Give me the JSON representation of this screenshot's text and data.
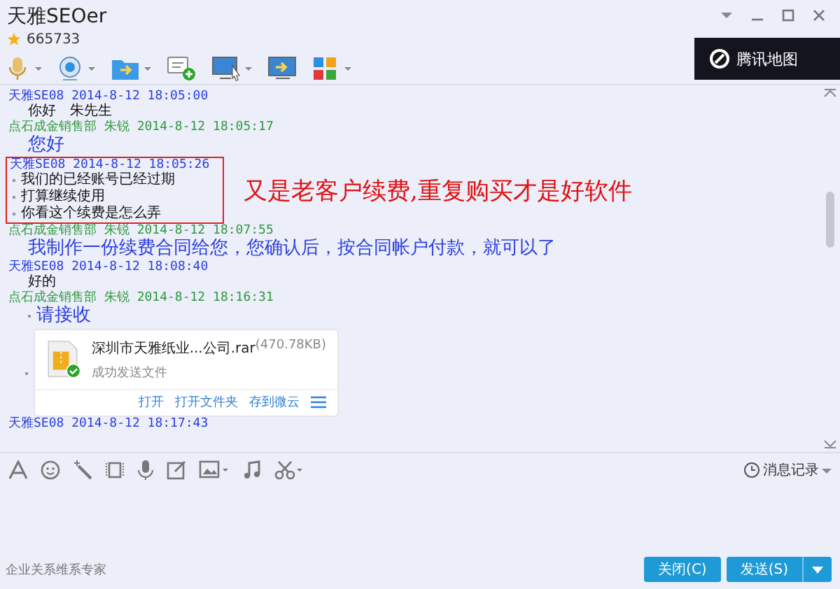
{
  "window": {
    "title": "天雅SEOer",
    "account": "665733"
  },
  "map_banner": {
    "label": "腾讯地图"
  },
  "messages": [
    {
      "sender": "天雅SE08",
      "time": "2014-8-12 18:05:00",
      "kind": "me",
      "highlighted": false,
      "lines": [
        {
          "text": "你好　朱先生",
          "kind": "normal",
          "bulleted": false
        }
      ]
    },
    {
      "sender": "点石成金销售部 朱锐",
      "time": "2014-8-12 18:05:17",
      "kind": "contact",
      "highlighted": false,
      "lines": [
        {
          "text": "您好",
          "kind": "large",
          "bulleted": false
        }
      ]
    },
    {
      "sender": "天雅SE08",
      "time": "2014-8-12 18:05:26",
      "kind": "me",
      "highlighted": true,
      "annotation": "又是老客户续费,重复购买才是好软件",
      "lines": [
        {
          "text": "我们的已经账号已经过期",
          "kind": "normal",
          "bulleted": true
        },
        {
          "text": "打算继续使用",
          "kind": "normal",
          "bulleted": true
        },
        {
          "text": "你看这个续费是怎么弄",
          "kind": "normal",
          "bulleted": true
        }
      ]
    },
    {
      "sender": "点石成金销售部 朱锐",
      "time": "2014-8-12 18:07:55",
      "kind": "contact",
      "highlighted": false,
      "lines": [
        {
          "text": "我制作一份续费合同给您，您确认后，按合同帐户付款，就可以了",
          "kind": "large",
          "bulleted": false
        }
      ]
    },
    {
      "sender": "天雅SE08",
      "time": "2014-8-12 18:08:40",
      "kind": "me",
      "highlighted": false,
      "lines": [
        {
          "text": "好的",
          "kind": "normal",
          "bulleted": false
        }
      ]
    },
    {
      "sender": "点石成金销售部 朱锐",
      "time": "2014-8-12 18:16:31",
      "kind": "contact",
      "highlighted": false,
      "lines": [
        {
          "text": "请接收",
          "kind": "large",
          "bulleted": true
        }
      ],
      "file": {
        "name": "深圳市天雅纸业...公司.rar",
        "size": "(470.78KB)",
        "status": "成功发送文件",
        "actions": [
          "打开",
          "打开文件夹",
          "存到微云"
        ]
      }
    },
    {
      "sender": "天雅SE08",
      "time": "2014-8-12 18:17:43",
      "kind": "me",
      "highlighted": false
    }
  ],
  "history_button": "消息记录",
  "footer": {
    "slogan": "企业关系维系专家",
    "close_button": "关闭(C)",
    "send_button": "发送(S)"
  }
}
